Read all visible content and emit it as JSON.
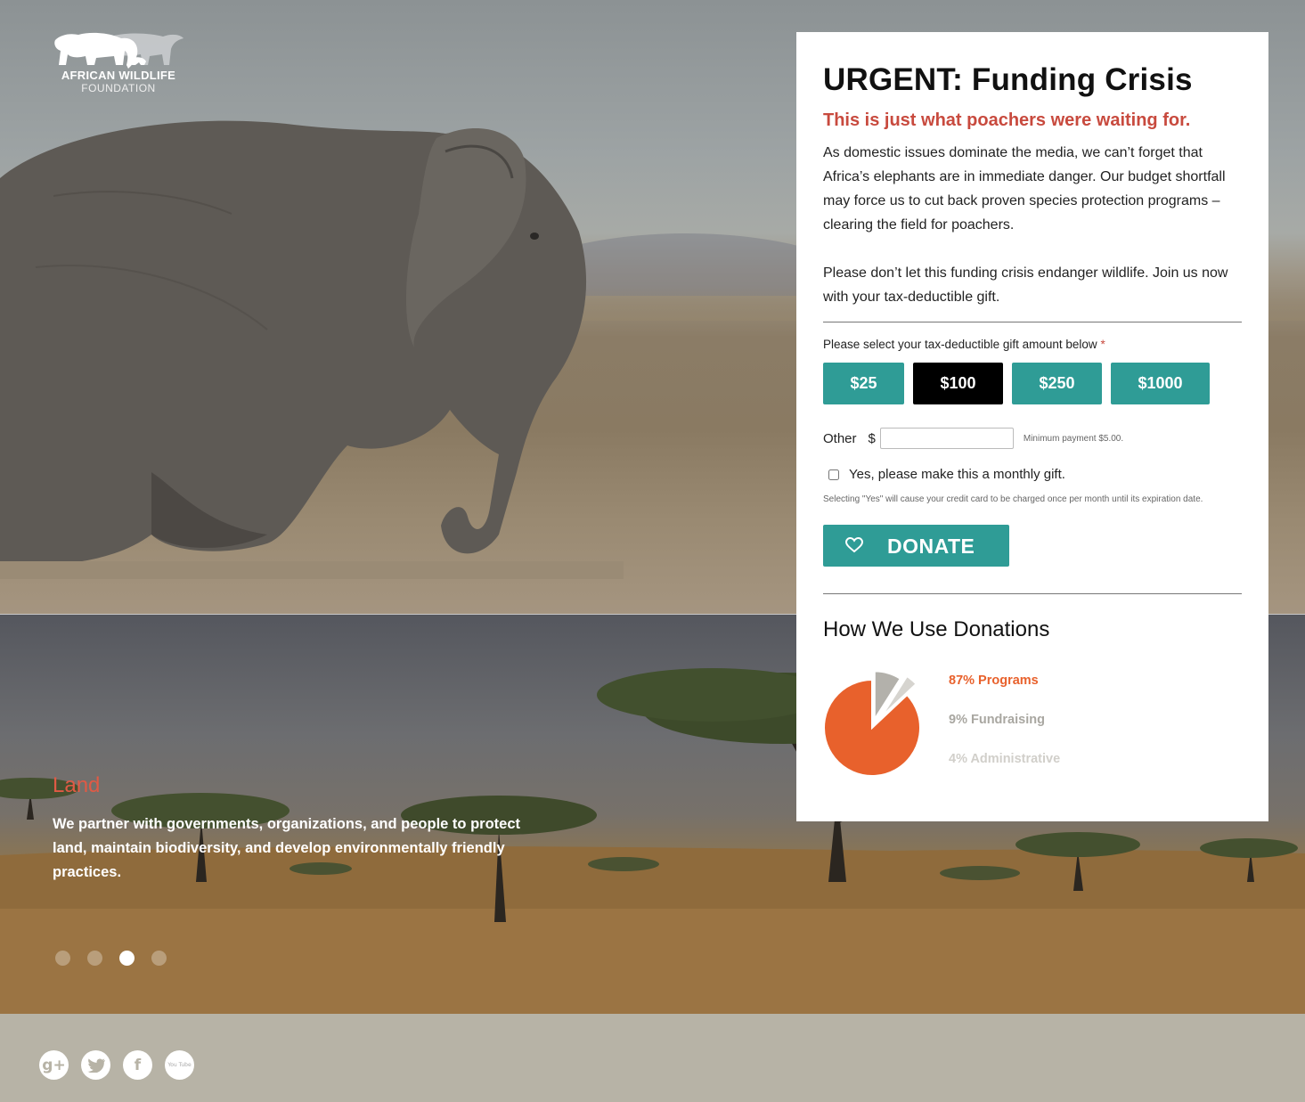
{
  "logo": {
    "line1": "AFRICAN WILDLIFE",
    "line2": "FOUNDATION"
  },
  "slide": {
    "title": "Land",
    "text": "We partner with governments, organizations, and people to protect land, maintain biodiversity, and develop environmentally friendly practices.",
    "dots": 4,
    "active_dot": 3
  },
  "panel": {
    "title": "URGENT: Funding Crisis",
    "subtitle": "This is just what poachers were waiting for.",
    "paragraph1": "As domestic issues dominate the media, we can’t forget that Africa’s elephants are in immediate danger. Our budget shortfall may force us to cut back proven species protection programs – clearing the field for poachers.",
    "paragraph2": "Please don’t let this funding crisis endanger wildlife. Join us now with your tax-deductible gift.",
    "select_label": "Please select your tax-deductible gift amount below",
    "required_mark": "*",
    "amounts": [
      {
        "label": "$25",
        "selected": false
      },
      {
        "label": "$100",
        "selected": true
      },
      {
        "label": "$250",
        "selected": false
      },
      {
        "label": "$1000",
        "selected": false
      }
    ],
    "other_label": "Other",
    "currency": "$",
    "other_value": "",
    "min_payment": "Minimum payment $5.00.",
    "monthly_label": "Yes, please make this a monthly gift.",
    "monthly_checked": false,
    "monthly_note": "Selecting \"Yes\" will cause your credit card to be charged once per month until its expiration date.",
    "donate_label": "DONATE",
    "donate_icon": "heart-icon",
    "usage_title": "How We Use Donations"
  },
  "chart_data": {
    "type": "pie",
    "slices": [
      {
        "label": "87% Programs",
        "value": 87,
        "color": "#e8612c"
      },
      {
        "label": "9% Fundraising",
        "value": 9,
        "color": "#b3b1ab"
      },
      {
        "label": "4% Administrative",
        "value": 4,
        "color": "#d6d4cf"
      }
    ]
  },
  "colors": {
    "accent": "#2f9c96",
    "alert": "#c84a3e",
    "selected": "#000000"
  },
  "social": [
    {
      "name": "google-plus-icon",
      "glyph": "g+"
    },
    {
      "name": "twitter-icon",
      "glyph": "🐦"
    },
    {
      "name": "facebook-icon",
      "glyph": "f"
    },
    {
      "name": "youtube-icon",
      "glyph": "You Tube"
    }
  ]
}
